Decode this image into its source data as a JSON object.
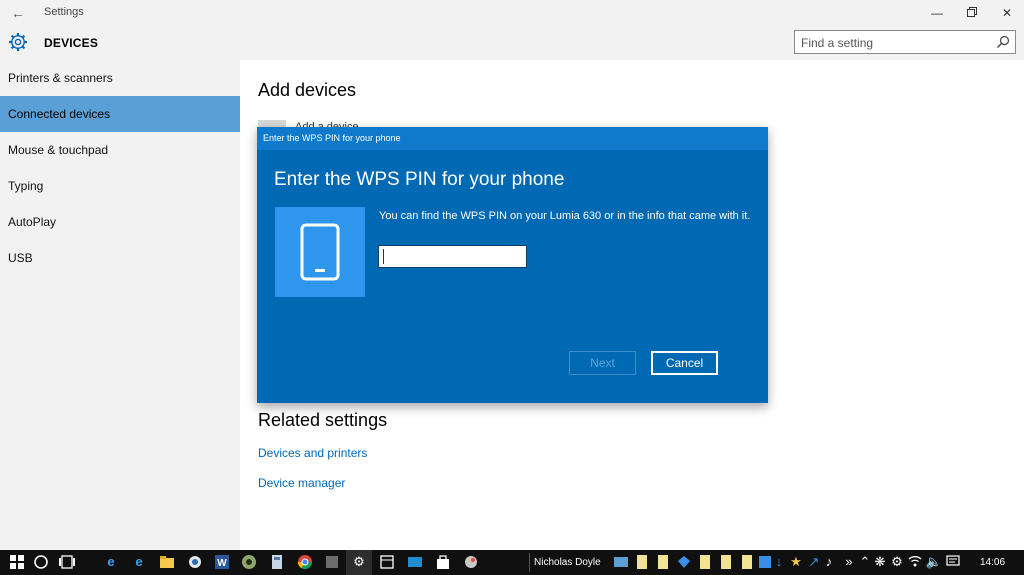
{
  "window": {
    "back_icon": "back-arrow-icon",
    "app_title": "Settings",
    "minimize_icon": "minimize-icon",
    "restore_icon": "restore-icon",
    "close_icon": "close-icon"
  },
  "header": {
    "icon": "gear-icon",
    "title": "DEVICES",
    "search_placeholder": "Find a setting",
    "search_icon": "search-icon"
  },
  "sidebar": {
    "items": [
      {
        "label": "Printers & scanners",
        "selected": false
      },
      {
        "label": "Connected devices",
        "selected": true
      },
      {
        "label": "Mouse & touchpad",
        "selected": false
      },
      {
        "label": "Typing",
        "selected": false
      },
      {
        "label": "AutoPlay",
        "selected": false
      },
      {
        "label": "USB",
        "selected": false
      }
    ]
  },
  "main": {
    "heading": "Add devices",
    "partial_item": "Add a device",
    "related_heading": "Related settings",
    "links": [
      {
        "label": "Devices and printers"
      },
      {
        "label": "Device manager"
      }
    ]
  },
  "dialog": {
    "window_title": "Enter the WPS PIN for your phone",
    "heading": "Enter the WPS PIN for your phone",
    "tile_icon": "phone-icon",
    "description": "You can find the WPS PIN on your Lumia 630 or in the info that came with it.",
    "pin_value": "",
    "next_label": "Next",
    "cancel_label": "Cancel"
  },
  "taskbar": {
    "user": "Nicholas Doyle",
    "time": "14:06",
    "icons": [
      "start-icon",
      "cortana-icon",
      "task-view-icon",
      "edge-icon",
      "ie-icon",
      "file-explorer-icon",
      "app-icon",
      "word-icon",
      "app-icon",
      "app-icon",
      "chrome-icon",
      "app-icon",
      "skype-icon",
      "settings-icon",
      "app-icon",
      "app-icon",
      "store-icon",
      "app-icon"
    ],
    "tray_icons": [
      "chevron-up-icon",
      "network-icon",
      "volume-icon",
      "notification-icon"
    ]
  },
  "colors": {
    "accent": "#0069b3",
    "sidebar_selected": "#5aa0d6",
    "link": "#0067b8",
    "tile": "#2e96ec"
  }
}
